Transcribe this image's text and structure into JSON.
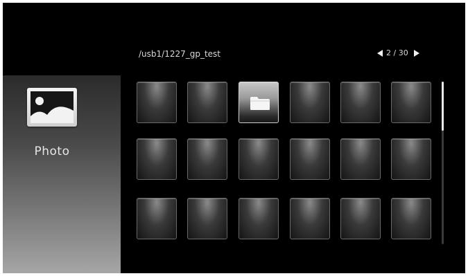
{
  "header": {
    "path": "/usb1/1227_gp_test",
    "pager_text": "2 / 30"
  },
  "sidebar": {
    "icon": "photo-icon",
    "label": "Photo"
  },
  "grid": {
    "rows": 3,
    "columns": 6,
    "selected_tile": 2,
    "selected_tile_icon": "folder-icon"
  },
  "scrollbar": {
    "position_fraction": 0.0,
    "visible_fraction": 0.3
  },
  "colors": {
    "background": "#000000",
    "text": "#d9d9d9",
    "tile_border": "#6a6a6a",
    "selected_border": "#d0d0d0"
  }
}
